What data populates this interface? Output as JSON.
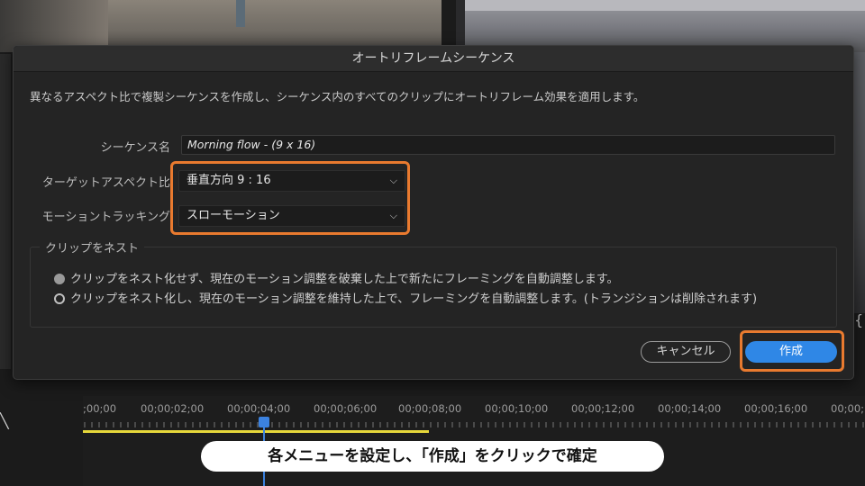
{
  "dialog": {
    "title": "オートリフレームシーケンス",
    "description": "異なるアスペクト比で複製シーケンスを作成し、シーケンス内のすべてのクリップにオートリフレーム効果を適用します。",
    "sequence_name": {
      "label": "シーケンス名",
      "value": "Morning flow - (9 x 16)"
    },
    "target_aspect": {
      "label": "ターゲットアスペクト比",
      "selected": "垂直方向 9 : 16"
    },
    "motion_tracking": {
      "label": "モーショントラッキング",
      "selected": "スローモーション"
    },
    "nest_group": {
      "title": "クリップをネスト",
      "options": [
        {
          "label": "クリップをネスト化せず、現在のモーション調整を破棄した上で新たにフレーミングを自動調整します。",
          "selected": true
        },
        {
          "label": "クリップをネスト化し、現在のモーション調整を維持した上で、フレーミングを自動調整します。(トランジションは削除されます)",
          "selected": false
        }
      ]
    },
    "cancel_label": "キャンセル",
    "create_label": "作成"
  },
  "timeline": {
    "ticks": [
      ";00;00",
      "00;00;02;00",
      "00;00;04;00",
      "00;00;06;00",
      "00;00;08;00",
      "00;00;10;00",
      "00;00;12;00",
      "00;00;14;00",
      "00;00;16;00",
      "00;00;1"
    ]
  },
  "caption": "各メニューを設定し、「作成」をクリックで確定",
  "colors": {
    "accent_blue": "#2f87e6",
    "highlight_orange": "#e97a2f",
    "work_area_yellow": "#e7d83b"
  }
}
